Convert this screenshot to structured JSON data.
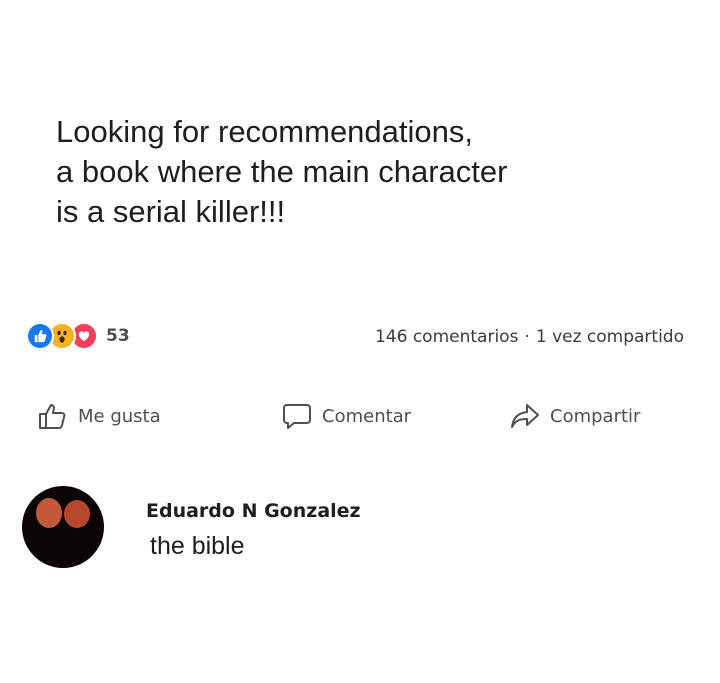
{
  "post": {
    "lines": [
      "Looking for recommendations,",
      "a book where the main character",
      "is a serial killer!!!"
    ]
  },
  "stats": {
    "reaction_count": "53",
    "comments": "146 comentarios",
    "separator": "·",
    "shares": "1 vez compartido"
  },
  "reactions": [
    {
      "icon": "like-reaction-icon",
      "color": "#1877f2"
    },
    {
      "icon": "wow-reaction-icon",
      "color": "#f7b125"
    },
    {
      "icon": "love-reaction-icon",
      "color": "#f33e58"
    }
  ],
  "actions": {
    "like_label": "Me gusta",
    "comment_label": "Comentar",
    "share_label": "Compartir"
  },
  "comment": {
    "author": "Eduardo N Gonzalez",
    "text": "the bible"
  }
}
